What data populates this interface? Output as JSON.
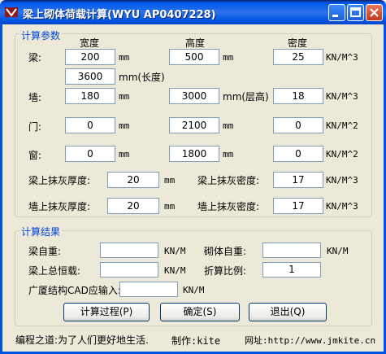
{
  "window": {
    "title": "梁上砌体荷载计算(WYU AP0407228)"
  },
  "params": {
    "legend": "计算参数",
    "headers": {
      "width": "宽度",
      "height": "高度",
      "density": "密度"
    },
    "beam": {
      "label": "梁:",
      "width": "200",
      "width_unit": "mm",
      "height": "500",
      "height_unit": "mm",
      "density": "25",
      "density_unit": "KN/M^3",
      "length": "3600",
      "length_unit": "mm(长度)"
    },
    "wall": {
      "label": "墙:",
      "width": "180",
      "width_unit": "mm",
      "height": "3000",
      "height_unit": "mm(层高)",
      "density": "18",
      "density_unit": "KN/M^3"
    },
    "door": {
      "label": "门:",
      "width": "0",
      "width_unit": "mm",
      "height": "2100",
      "height_unit": "mm",
      "density": "0",
      "density_unit": "KN/M^2"
    },
    "window": {
      "label": "窗:",
      "width": "0",
      "width_unit": "mm",
      "height": "1800",
      "height_unit": "mm",
      "density": "0",
      "density_unit": "KN/M^2"
    },
    "beam_plaster": {
      "thick_label": "梁上抹灰厚度:",
      "thick": "20",
      "thick_unit": "mm",
      "dens_label": "梁上抹灰密度:",
      "dens": "17",
      "dens_unit": "KN/M^3"
    },
    "wall_plaster": {
      "thick_label": "墙上抹灰厚度:",
      "thick": "20",
      "thick_unit": "mm",
      "dens_label": "墙上抹灰密度:",
      "dens": "17",
      "dens_unit": "KN/M^3"
    }
  },
  "results": {
    "legend": "计算结果",
    "beam_self_label": "梁自重:",
    "beam_self": "",
    "beam_self_unit": "KN/M",
    "masonry_self_label": "砌体自重:",
    "masonry_self": "",
    "masonry_self_unit": "KN/M",
    "beam_total_label": "梁上总恒载:",
    "beam_total": "",
    "beam_total_unit": "KN/M",
    "ratio_label": "折算比例:",
    "ratio": "1",
    "cad_label": "广厦结构CAD应输入:",
    "cad": "",
    "cad_unit": "KN/M"
  },
  "buttons": {
    "process": "计算过程(P)",
    "ok": "确定(S)",
    "exit": "退出(Q)"
  },
  "status": {
    "motto": "编程之道:为了人们更好地生活.",
    "author": "制作:kite",
    "url": "网址:http://www.jmkite.cn"
  }
}
